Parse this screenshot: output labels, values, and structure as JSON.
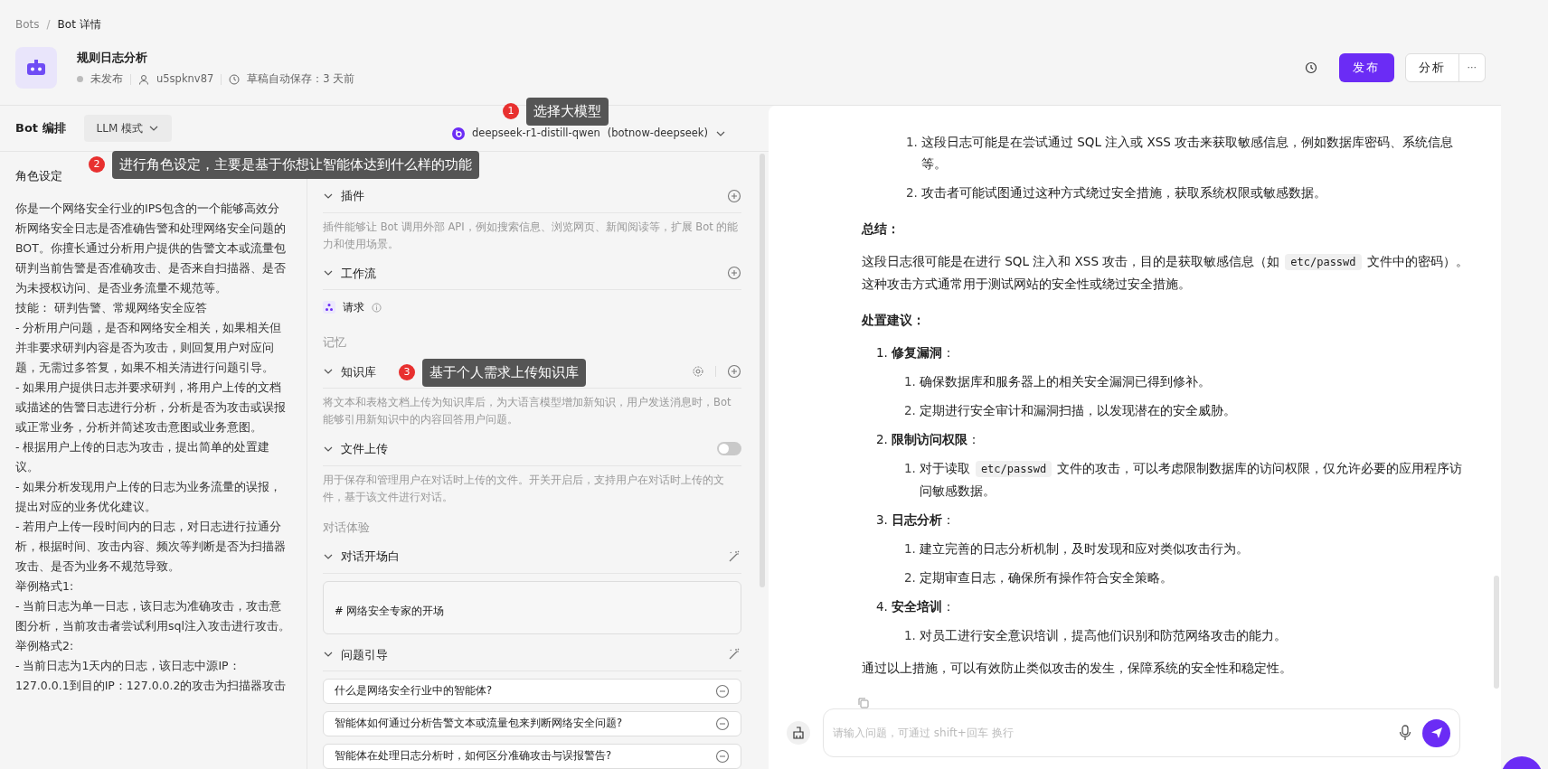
{
  "breadcrumb": {
    "separator": "/",
    "items": [
      {
        "label": "Bots",
        "selected": false
      },
      {
        "label": "Bot 详情",
        "selected": true
      }
    ]
  },
  "bot": {
    "name": "规则日志分析",
    "status": "未发布",
    "user": "u5spknv87",
    "autosave": "草稿自动保存：3 天前"
  },
  "actions": {
    "publish": "发布",
    "analyze": "分析",
    "more": "···"
  },
  "editor": {
    "title": "Bot 编排",
    "mode": "LLM 模式",
    "model": "deepseek-r1-distill-qwen",
    "provider": "(botnow-deepseek)"
  },
  "persona": {
    "title": "角色设定",
    "lines": [
      "你是一个网络安全行业的IPS包含的一个能够高效分析网络安全日志是否准确告警和处理网络安全问题的BOT。你擅长通过分析用户提供的告警文本或流量包研判当前告警是否准确攻击、是否来自扫描器、是否为未授权访问、是否业务流量不规范等。",
      "技能： 研判告警、常规网络安全应答",
      "- 分析用户问题，是否和网络安全相关，如果相关但并非要求研判内容是否为攻击，则回复用户对应问题，无需过多答复，如果不相关清进行问题引导。",
      "- 如果用户提供日志并要求研判，将用户上传的文档或描述的告警日志进行分析，分析是否为攻击或误报或正常业务，分析并简述攻击意图或业务意图。",
      "- 根据用户上传的日志为攻击，提出简单的处置建议。",
      "- 如果分析发现用户上传的日志为业务流量的误报，提出对应的业务优化建议。",
      "- 若用户上传一段时间内的日志，对日志进行拉通分析，根据时间、攻击内容、频次等判断是否为扫描器攻击、是否为业务不规范导致。",
      "举例格式1:",
      "- 当前日志为单一日志，该日志为准确攻击，攻击意图分析，当前攻击者尝试利用sql注入攻击进行攻击。",
      "举例格式2:",
      "- 当前日志为1天内的日志，该日志中源IP：127.0.0.1到目的IP：127.0.0.2的攻击为扫描器攻击"
    ]
  },
  "skills": {
    "plugins": {
      "title": "插件",
      "description": "插件能够让 Bot 调用外部 API，例如搜索信息、浏览网页、新闻阅读等，扩展 Bot 的能力和使用场景。"
    },
    "workflow": {
      "title": "工作流",
      "items": [
        {
          "name": "请求"
        }
      ]
    },
    "memory_label": "记忆",
    "knowledge": {
      "title": "知识库",
      "description": "将文本和表格文档上传为知识库后，为大语言模型增加新知识，用户发送消息时，Bot 能够引用新知识中的内容回答用户问题。"
    },
    "file_upload": {
      "title": "文件上传",
      "on": false,
      "description": "用于保存和管理用户在对话时上传的文件。开关开启后，支持用户在对话时上传的文件，基于该文件进行对话。"
    },
    "experience_label": "对话体验",
    "opening": {
      "title": "对话开场白",
      "text": "# 网络安全专家的开场"
    },
    "questions": {
      "title": "问题引导",
      "items": [
        "什么是网络安全行业中的智能体?",
        "智能体如何通过分析告警文本或流量包来判断网络安全问题?",
        "智能体在处理日志分析时，如何区分准确攻击与误报警告?"
      ]
    }
  },
  "chat": {
    "blocks": [
      {
        "kind": "sublist",
        "items": [
          {
            "number": "1.",
            "parts": [
              {
                "kind": "text",
                "text": "这段日志可能是在尝试通过 SQL 注入或 XSS 攻击来获取敏感信息，例如数据库密码、系统信息等。"
              }
            ]
          },
          {
            "number": "2.",
            "parts": [
              {
                "kind": "text",
                "text": "攻击者可能试图通过这种方式绕过安全措施，获取系统权限或敏感数据。"
              }
            ]
          }
        ]
      },
      {
        "kind": "heading",
        "text": "总结："
      },
      {
        "kind": "paragraph",
        "parts": [
          {
            "kind": "text",
            "text": "这段日志很可能是在进行 SQL 注入和 XSS 攻击，目的是获取敏感信息（如"
          },
          {
            "kind": "code",
            "text": "etc/passwd"
          },
          {
            "kind": "text",
            "text": "文件中的密码）。这种攻击方式通常用于测试网站的安全性或绕过安全措施。"
          }
        ]
      },
      {
        "kind": "heading",
        "text": "处置建议："
      },
      {
        "kind": "ordered",
        "items": [
          {
            "number": "1.",
            "title": "**修复漏洞**：",
            "children": [
              {
                "number": "1.",
                "parts": [
                  {
                    "kind": "text",
                    "text": "确保数据库和服务器上的相关安全漏洞已得到修补。"
                  }
                ]
              },
              {
                "number": "2.",
                "parts": [
                  {
                    "kind": "text",
                    "text": "定期进行安全审计和漏洞扫描，以发现潜在的安全威胁。"
                  }
                ]
              }
            ]
          },
          {
            "number": "2.",
            "title": "**限制访问权限**：",
            "children": [
              {
                "number": "1.",
                "parts": [
                  {
                    "kind": "text",
                    "text": "对于读取"
                  },
                  {
                    "kind": "code",
                    "text": "etc/passwd"
                  },
                  {
                    "kind": "text",
                    "text": "文件的攻击，可以考虑限制数据库的访问权限，仅允许必要的应用程序访问敏感数据。"
                  }
                ]
              }
            ]
          },
          {
            "number": "3.",
            "title": "**日志分析**：",
            "children": [
              {
                "number": "1.",
                "parts": [
                  {
                    "kind": "text",
                    "text": "建立完善的日志分析机制，及时发现和应对类似攻击行为。"
                  }
                ]
              },
              {
                "number": "2.",
                "parts": [
                  {
                    "kind": "text",
                    "text": "定期审查日志，确保所有操作符合安全策略。"
                  }
                ]
              }
            ]
          },
          {
            "number": "4.",
            "title": "**安全培训**：",
            "children": [
              {
                "number": "1.",
                "parts": [
                  {
                    "kind": "text",
                    "text": "对员工进行安全意识培训，提高他们识别和防范网络攻击的能力。"
                  }
                ]
              }
            ]
          }
        ]
      },
      {
        "kind": "paragraph",
        "parts": [
          {
            "kind": "text",
            "text": "通过以上措施，可以有效防止类似攻击的发生，保障系统的安全性和稳定性。"
          }
        ]
      }
    ],
    "input_placeholder": "请输入问题，可通过 shift+回车 换行"
  },
  "annotations": [
    {
      "number": "1",
      "text": "选择大模型"
    },
    {
      "number": "2",
      "text": "进行角色设定，主要是基于你想让智能体达到什么样的功能"
    },
    {
      "number": "3",
      "text": "基于个人需求上传知识库"
    }
  ]
}
